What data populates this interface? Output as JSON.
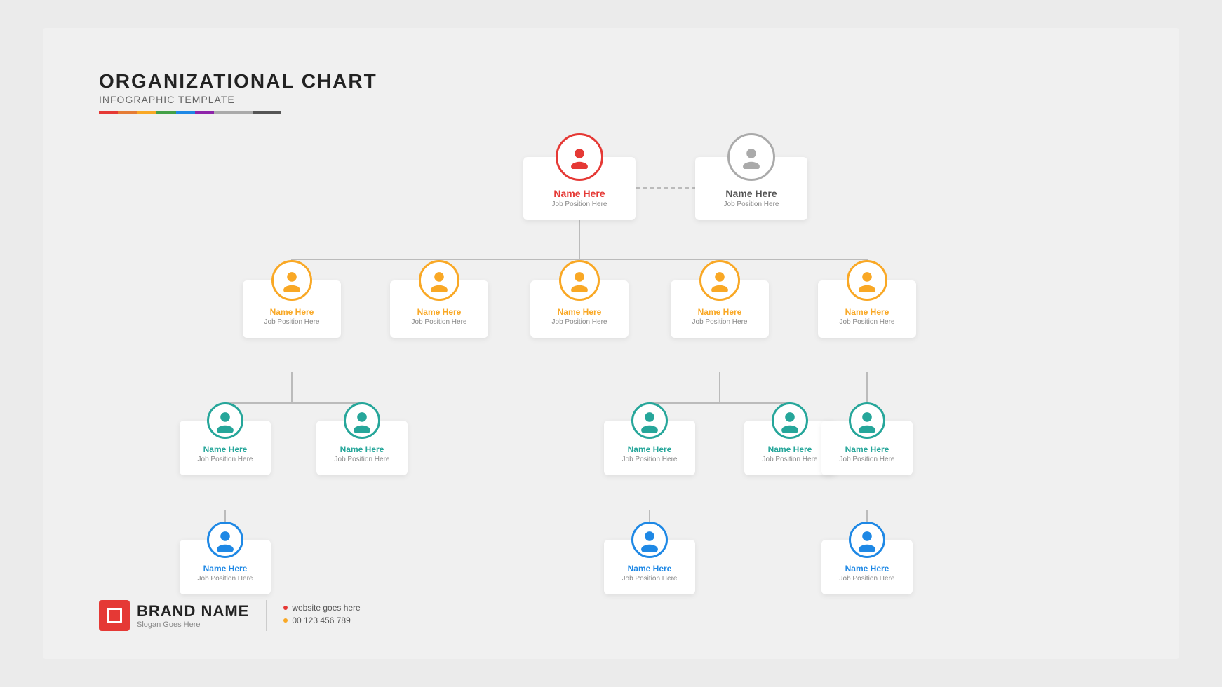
{
  "header": {
    "title": "ORGANIZATIONAL CHART",
    "subtitle": "INFOGRAPHIC TEMPLATE"
  },
  "rainbow": [
    "#e53935",
    "#f9a825",
    "#43a047",
    "#1e88e5",
    "#8e24aa",
    "#aaa",
    "#ccc"
  ],
  "brand": {
    "name": "BRAND NAME",
    "slogan": "Slogan Goes Here",
    "website": "website goes here",
    "phone": "00 123 456 789"
  },
  "nodes": {
    "ceo": {
      "name": "Name Here",
      "job": "Job Position Here"
    },
    "coo": {
      "name": "Name Here",
      "job": "Job Position Here"
    },
    "l1_1": {
      "name": "Name Here",
      "job": "Job Position Here"
    },
    "l1_2": {
      "name": "Name Here",
      "job": "Job Position Here"
    },
    "l1_3": {
      "name": "Name Here",
      "job": "Job Position Here"
    },
    "l1_4": {
      "name": "Name Here",
      "job": "Job Position Here"
    },
    "l1_5": {
      "name": "Name Here",
      "job": "Job Position Here"
    },
    "l2_1": {
      "name": "Name Here",
      "job": "Job Position Here"
    },
    "l2_2": {
      "name": "Name Here",
      "job": "Job Position Here"
    },
    "l2_3": {
      "name": "Name Here",
      "job": "Job Position Here"
    },
    "l2_4": {
      "name": "Name Here",
      "job": "Job Position Here"
    },
    "l2_5": {
      "name": "Name Here",
      "job": "Job Position Here"
    },
    "l3_1": {
      "name": "Name Here",
      "job": "Job Position Here"
    },
    "l3_2": {
      "name": "Name Here",
      "job": "Job Position Here"
    }
  }
}
